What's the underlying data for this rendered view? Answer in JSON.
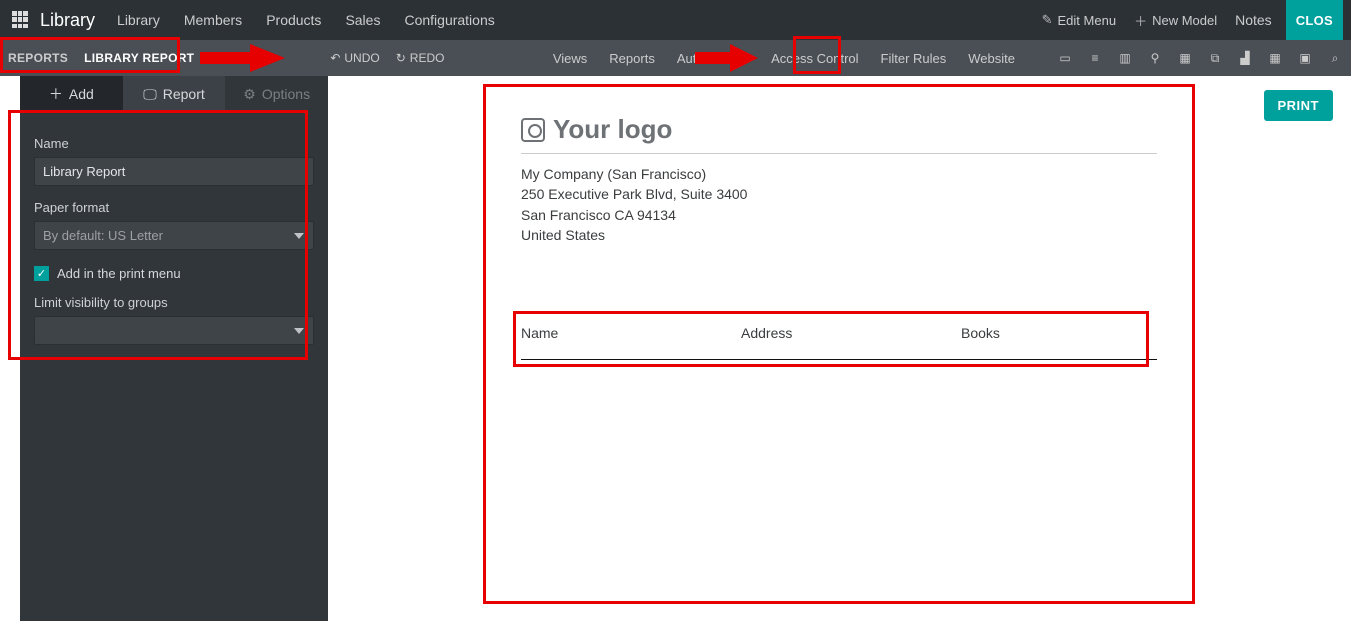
{
  "topbar": {
    "brand": "Library",
    "menu": [
      "Library",
      "Members",
      "Products",
      "Sales",
      "Configurations"
    ],
    "edit_menu": "Edit Menu",
    "new_model": "New Model",
    "notes": "Notes",
    "close": "CLOS"
  },
  "subbar": {
    "crumb1": "REPORTS",
    "crumb2": "LIBRARY REPORT",
    "undo": "UNDO",
    "redo": "REDO",
    "tools": [
      "Views",
      "Reports",
      "Automations",
      "Access Control",
      "Filter Rules",
      "Website"
    ]
  },
  "side": {
    "tab_add": "Add",
    "tab_report": "Report",
    "tab_options": "Options",
    "name_lbl": "Name",
    "name_val": "Library Report",
    "paper_lbl": "Paper format",
    "paper_val": "By default: US Letter",
    "print_chk": "Add in the print menu",
    "groups_lbl": "Limit visibility to groups"
  },
  "report": {
    "print": "PRINT",
    "logo_text": "Your logo",
    "company": "My Company (San Francisco)",
    "street": "250 Executive Park Blvd, Suite 3400",
    "city": "San Francisco CA 94134",
    "country": "United States",
    "cols": {
      "c1": "Name",
      "c2": "Address",
      "c3": "Books"
    }
  }
}
